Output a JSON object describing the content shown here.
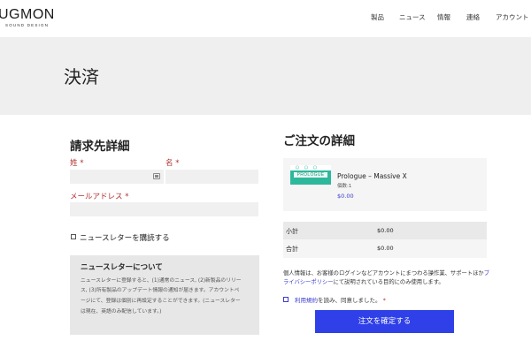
{
  "header": {
    "logo_text": "UGMON",
    "logo_sub": "SOUND DESIGN",
    "nav": [
      {
        "label": "製品"
      },
      {
        "label": "ニュース"
      },
      {
        "label": "情報"
      },
      {
        "label": "連絡"
      },
      {
        "label": "アカウント"
      }
    ]
  },
  "page_title": "決済",
  "billing": {
    "heading": "請求先詳細",
    "last_name_label": "姓",
    "first_name_label": "名",
    "email_label": "メールアドレス",
    "required_mark": "*",
    "last_name_value": "",
    "first_name_value": "",
    "email_value": "",
    "newsletter_checkbox_label": "ニュースレターを購読する",
    "newsletter_box": {
      "title": "ニュースレターについて",
      "lines": [
        "ニュースレターに登録すると、(1)通常のニュース, (2)新製品のリリー",
        "ス, (3)所有製品のアップデート情報の通知が届きます。アカウントペ",
        "ージにて、登録は個別に再設定することができます。(ニュースレター",
        "は現在、英語のみ配信しています。)"
      ]
    }
  },
  "order": {
    "heading": "ご注文の詳細",
    "product": {
      "name": "Prologue – Massive X",
      "qty": "個数:1",
      "price": "$0.00",
      "thumb_text": "PROLOGUE"
    },
    "subtotal_label": "小計",
    "subtotal_value": "$0.00",
    "total_label": "合計",
    "total_value": "$0.00",
    "privacy_text_1": "個人情報は、お客様のログインなどアカウントにまつわる操作業、サポートほか",
    "privacy_link": "プライバシーポリシー",
    "privacy_text_2": "にて説明されている目的にのみ使用します。",
    "terms_link": "利用規約",
    "terms_text": "を読み、同意しました。",
    "required_mark": "*",
    "submit_label": "注文を確定する"
  },
  "colors": {
    "accent": "#2f40e8",
    "link": "#3a3ad0",
    "required": "#b03030",
    "thumb": "#2db89c"
  }
}
